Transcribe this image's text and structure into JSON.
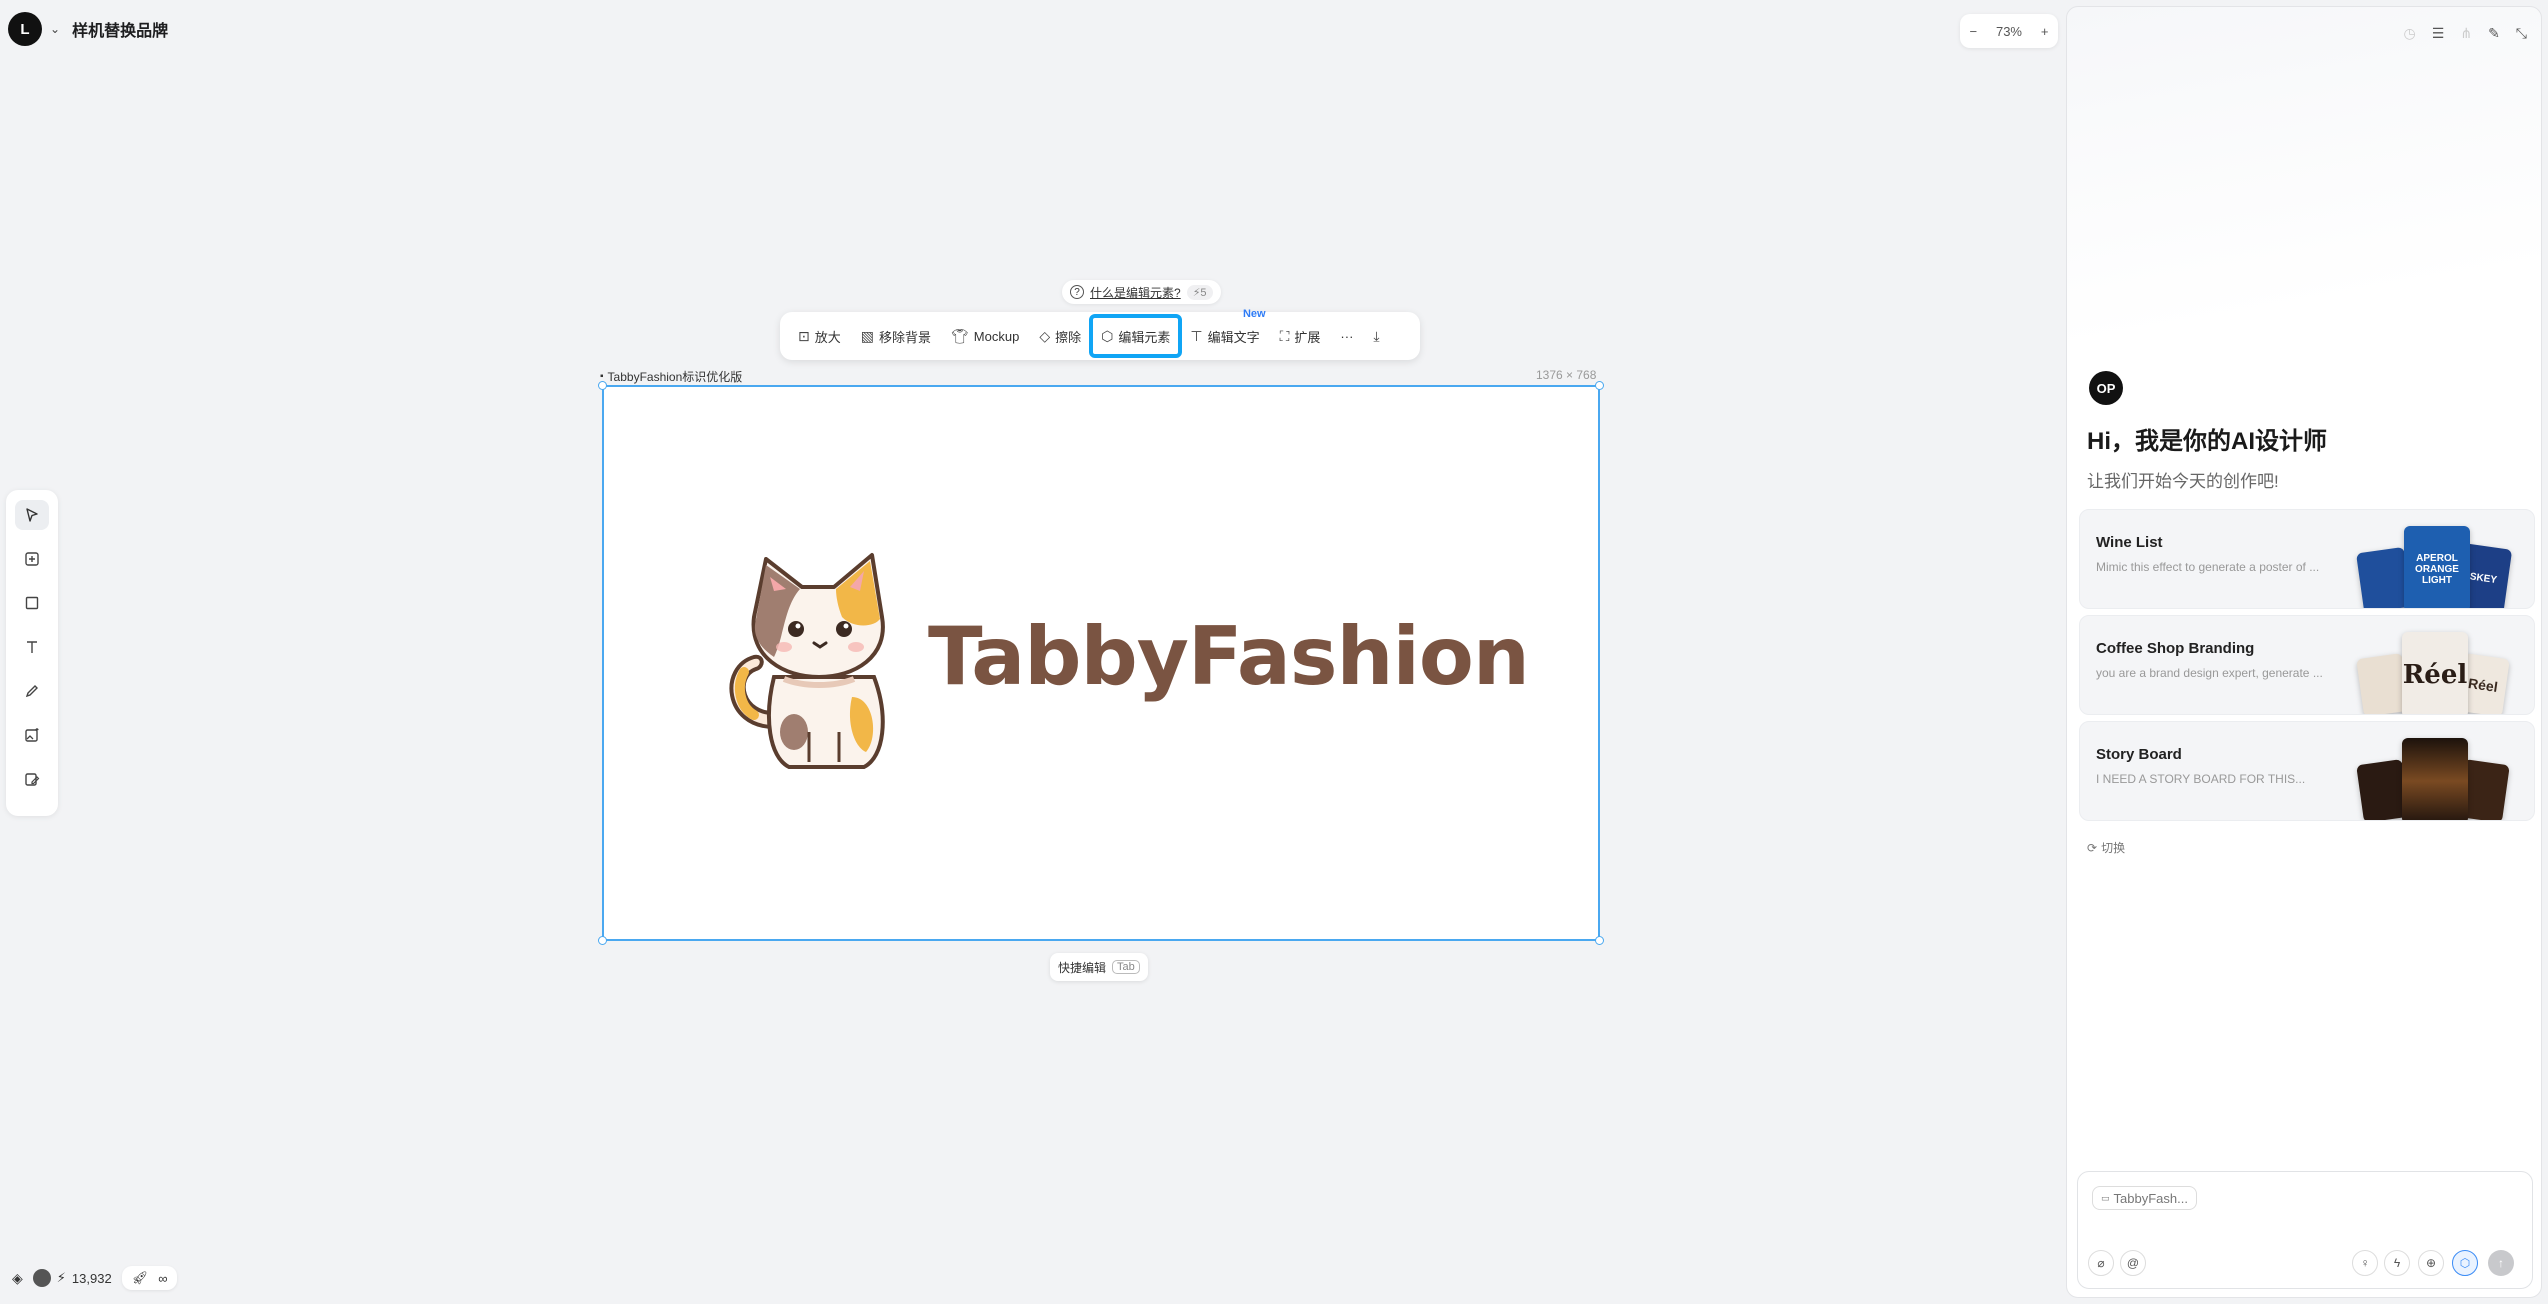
{
  "app": {
    "logo_text": "L",
    "project_title": "样机替换品牌"
  },
  "zoom": {
    "minus": "−",
    "value": "73%",
    "plus": "+"
  },
  "help": {
    "text": "什么是编辑元素?",
    "cost": "⚡5"
  },
  "toolbar": {
    "items": [
      {
        "label": "放大",
        "icon": "upscale-icon"
      },
      {
        "label": "移除背景",
        "icon": "remove-bg-icon"
      },
      {
        "label": "Mockup",
        "icon": "shirt-icon"
      },
      {
        "label": "擦除",
        "icon": "eraser-icon"
      },
      {
        "label": "编辑元素",
        "icon": "cube-icon"
      },
      {
        "label": "编辑文字",
        "icon": "text-edit-icon"
      },
      {
        "label": "扩展",
        "icon": "expand-icon"
      }
    ],
    "new_badge": "New",
    "more": "···",
    "download": "⤓"
  },
  "canvas": {
    "frame_label": "TabbyFashion标识优化版",
    "frame_size": "1376 × 768",
    "brand_text": "TabbyFashion",
    "quick_edit_label": "快捷编辑",
    "quick_edit_key": "Tab"
  },
  "bottom": {
    "credits": "13,932"
  },
  "panel": {
    "avatar_text": "OP",
    "greeting": "Hi，我是你的AI设计师",
    "subtitle": "让我们开始今天的创作吧!",
    "cards": [
      {
        "title": "Wine List",
        "desc": "Mimic this effect to generate a poster of ..."
      },
      {
        "title": "Coffee Shop Branding",
        "desc": "you are a brand design expert, generate ..."
      },
      {
        "title": "Story Board",
        "desc": "I NEED A STORY BOARD FOR THIS..."
      }
    ],
    "switch_label": "切换",
    "composer_chip": "TabbyFash...",
    "thumb_texts": {
      "aperol": "APEROL ORANGE LIGHT",
      "whiskey": "ISKEY",
      "reel": "Réel"
    }
  },
  "colors": {
    "accent": "#10a5f5",
    "frame_border": "#4aa8f0",
    "brand_brown": "#7a5442",
    "new_badge": "#2f7cf6"
  }
}
